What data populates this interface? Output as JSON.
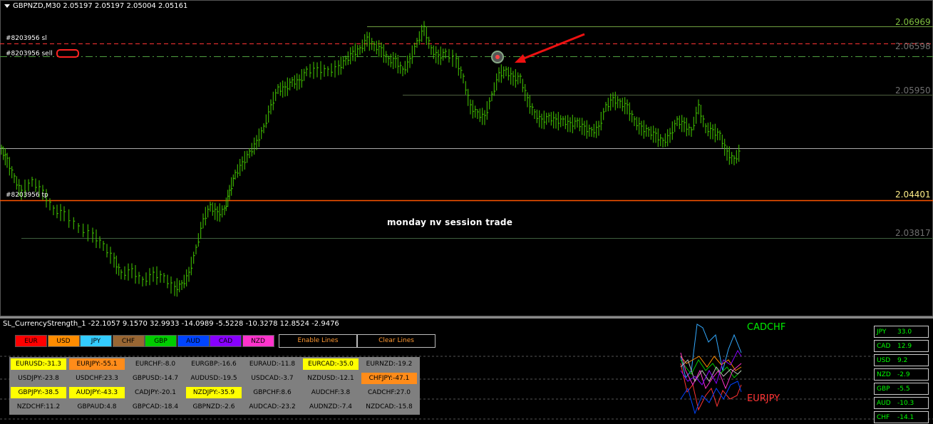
{
  "header": {
    "symbol_info": "GBPNZD,M30  2.05197 2.05197 2.05004 2.05161"
  },
  "price_levels": [
    {
      "label": "2.06969",
      "color": "#7fbf3f"
    },
    {
      "label": "2.06598",
      "color": "#6f6f6f"
    },
    {
      "label": "2.05950",
      "color": "#6f6f6f"
    },
    {
      "label": "2.04401",
      "color": "#ffee88"
    },
    {
      "label": "2.03817",
      "color": "#6f6f6f"
    }
  ],
  "orders": {
    "sl": "#8203956 sl",
    "sell": "#8203956 sell",
    "tp": "#8203956 tp"
  },
  "annotation": "monday nv session trade",
  "indicator": {
    "title": "SL_CurrencyStrength_1 -22.1057 9.1570 32.9933 -14.0989 -5.5228 -10.3278 12.8524 -2.9476",
    "currency_buttons": [
      {
        "label": "EUR",
        "color": "#ff0000"
      },
      {
        "label": "USD",
        "color": "#ff8c00"
      },
      {
        "label": "JPY",
        "color": "#33ccff"
      },
      {
        "label": "CHF",
        "color": "#996633"
      },
      {
        "label": "GBP",
        "color": "#00cc00"
      },
      {
        "label": "AUD",
        "color": "#0044ff"
      },
      {
        "label": "CAD",
        "color": "#8800ff"
      },
      {
        "label": "NZD",
        "color": "#ff33cc"
      }
    ],
    "enable_lines": "Enable Lines",
    "clear_lines": "Clear Lines",
    "pairs": [
      [
        {
          "t": "EURUSD:-31.3",
          "c": "#ffff00"
        },
        {
          "t": "EURJPY:-55.1",
          "c": "#ff8c1a"
        },
        {
          "t": "EURCHF:-8.0",
          "c": ""
        },
        {
          "t": "EURGBP:-16.6",
          "c": ""
        },
        {
          "t": "EURAUD:-11.8",
          "c": ""
        },
        {
          "t": "EURCAD:-35.0",
          "c": "#ffff00"
        },
        {
          "t": "EURNZD:-19.2",
          "c": ""
        }
      ],
      [
        {
          "t": "USDJPY:-23.8",
          "c": ""
        },
        {
          "t": "USDCHF:23.3",
          "c": ""
        },
        {
          "t": "GBPUSD:-14.7",
          "c": ""
        },
        {
          "t": "AUDUSD:-19.5",
          "c": ""
        },
        {
          "t": "USDCAD:-3.7",
          "c": ""
        },
        {
          "t": "NZDUSD:-12.1",
          "c": ""
        },
        {
          "t": "CHFJPY:-47.1",
          "c": "#ff8c1a"
        }
      ],
      [
        {
          "t": "GBPJPY:-38.5",
          "c": "#ffff00"
        },
        {
          "t": "AUDJPY:-43.3",
          "c": "#ffff00"
        },
        {
          "t": "CADJPY:-20.1",
          "c": ""
        },
        {
          "t": "NZDJPY:-35.9",
          "c": "#ffff00"
        },
        {
          "t": "GBPCHF:8.6",
          "c": ""
        },
        {
          "t": "AUDCHF:3.8",
          "c": ""
        },
        {
          "t": "CADCHF:27.0",
          "c": ""
        }
      ],
      [
        {
          "t": "NZDCHF:11.2",
          "c": ""
        },
        {
          "t": "GBPAUD:4.8",
          "c": ""
        },
        {
          "t": "GBPCAD:-18.4",
          "c": ""
        },
        {
          "t": "GBPNZD:-2.6",
          "c": ""
        },
        {
          "t": "AUDCAD:-23.2",
          "c": ""
        },
        {
          "t": "AUDNZD:-7.4",
          "c": ""
        },
        {
          "t": "NZDCAD:-15.8",
          "c": ""
        }
      ]
    ],
    "strongest_pair": "CADCHF",
    "weakest_pair": "EURJPY",
    "strength_list": [
      {
        "ccy": "JPY",
        "val": "33.0"
      },
      {
        "ccy": "CAD",
        "val": "12.9"
      },
      {
        "ccy": "USD",
        "val": "9.2"
      },
      {
        "ccy": "NZD",
        "val": "-2.9"
      },
      {
        "ccy": "GBP",
        "val": "-5.5"
      },
      {
        "ccy": "AUD",
        "val": "-10.3"
      },
      {
        "ccy": "CHF",
        "val": "-14.1"
      }
    ]
  },
  "colors": {
    "candles": "#44cc00",
    "sl_line": "#ff3333",
    "tp_line": "#ff4400",
    "arrow": "#ff1111",
    "strength_text": "#00ff00"
  }
}
